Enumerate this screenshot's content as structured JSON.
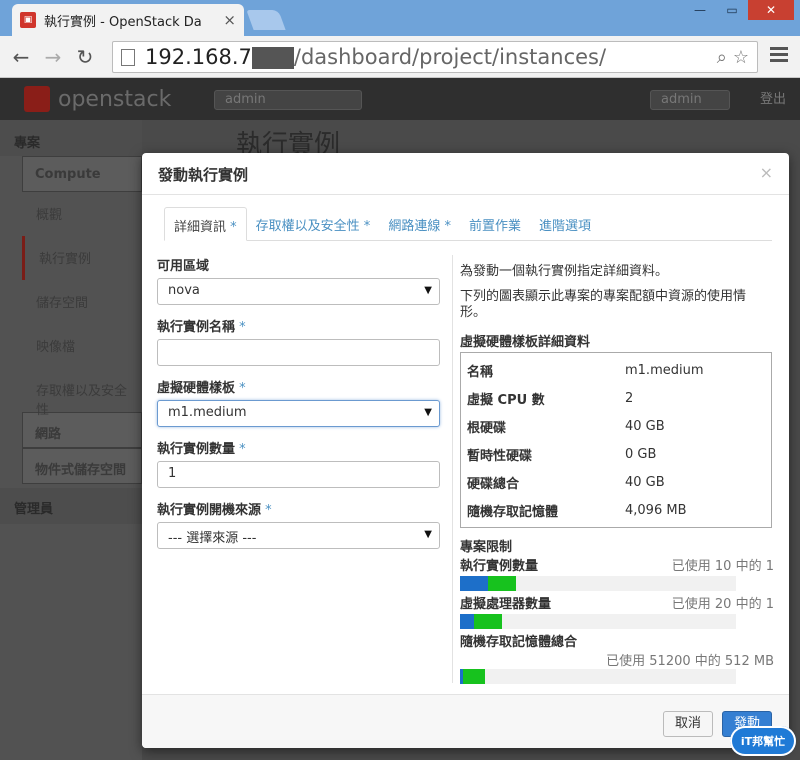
{
  "browser": {
    "tab_title": "執行實例 - OpenStack Da",
    "url_host": "192.168.7",
    "url_path": "/dashboard/project/instances/"
  },
  "dashboard": {
    "logo_text": "openstack",
    "project_select": "admin",
    "user_select": "admin",
    "logout": "登出",
    "page_heading": "執行實例",
    "sidebar": {
      "project": "專案",
      "compute": "Compute",
      "items": [
        "概觀",
        "執行實例",
        "儲存空間",
        "映像檔",
        "存取權以及安全性"
      ],
      "network": "網路",
      "object_store": "物件式儲存空間",
      "admin": "管理員"
    }
  },
  "modal": {
    "title": "發動執行實例",
    "close": "×",
    "tabs": [
      {
        "label": "詳細資訊",
        "star": " *"
      },
      {
        "label": "存取權以及安全性",
        "star": " *"
      },
      {
        "label": "網路連線",
        "star": " *"
      },
      {
        "label": "前置作業",
        "star": ""
      },
      {
        "label": "進階選項",
        "star": ""
      }
    ],
    "fields": {
      "availability_zone": {
        "label": "可用區域",
        "value": "nova"
      },
      "instance_name": {
        "label": "執行實例名稱",
        "req": " *",
        "value": ""
      },
      "flavor": {
        "label": "虛擬硬體樣板",
        "req": " *",
        "value": "m1.medium"
      },
      "instance_count": {
        "label": "執行實例數量",
        "req": " *",
        "value": "1"
      },
      "boot_source": {
        "label": "執行實例開機來源",
        "req": " *",
        "value": "--- 選擇來源 ---"
      }
    },
    "help": {
      "line1": "為發動一個執行實例指定詳細資料。",
      "line2": "下列的圖表顯示此專案的專案配額中資源的使用情形。"
    },
    "flavor_details": {
      "heading": "虛擬硬體樣板詳細資料",
      "rows": [
        {
          "key": "名稱",
          "value": "m1.medium"
        },
        {
          "key": "虛擬 CPU 數",
          "value": "2"
        },
        {
          "key": "根硬碟",
          "value": "40 GB"
        },
        {
          "key": "暫時性硬碟",
          "value": "0 GB"
        },
        {
          "key": "硬碟總合",
          "value": "40 GB"
        },
        {
          "key": "隨機存取記憶體",
          "value": "4,096 MB"
        }
      ]
    },
    "limits": {
      "heading": "專案限制",
      "items": [
        {
          "name": "執行實例數量",
          "used": "已使用 10 中的 1",
          "used_fraction": 0.1,
          "added_fraction": 0.1
        },
        {
          "name": "虛擬處理器數量",
          "used": "已使用 20 中的 1",
          "used_fraction": 0.05,
          "added_fraction": 0.1
        },
        {
          "name": "隨機存取記憶體總合",
          "used": "已使用 51200 中的 512 MB",
          "used_fraction": 0.01,
          "added_fraction": 0.08
        }
      ]
    },
    "buttons": {
      "cancel": "取消",
      "launch": "發動"
    }
  },
  "watermark": "iT邦幫忙"
}
